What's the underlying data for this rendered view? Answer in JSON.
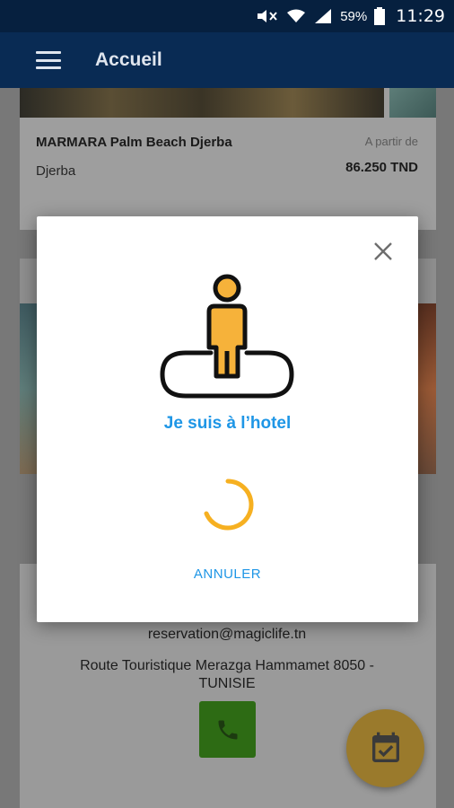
{
  "status_bar": {
    "battery_percent": "59%",
    "time": "11:29",
    "icons": [
      "mute-icon",
      "wifi-icon",
      "signal-icon",
      "battery-icon"
    ]
  },
  "app_bar": {
    "title": "Accueil",
    "menu_icon": "hamburger-menu-icon"
  },
  "hotel_card": {
    "name": "MARMARA Palm Beach Djerba",
    "city": "Djerba",
    "price_prefix": "A partir de",
    "price": "86.250 TND"
  },
  "contact": {
    "email": "reservation@magiclife.tn",
    "address": "Route Touristique Merazga Hammamet 8050 - TUNISIE",
    "phone_icon": "phone-icon"
  },
  "fab": {
    "icon": "calendar-check-icon"
  },
  "dialog": {
    "close_icon": "close-icon",
    "illustration": "person-at-hotel-icon",
    "title": "Je suis à l’hotel",
    "spinner": "loading-spinner",
    "cancel_label": "ANNULER"
  },
  "colors": {
    "accent": "#1e96e6",
    "spinner": "#f6b021",
    "person_fill": "#f6b23a",
    "app_bar": "#092b54",
    "phone_button": "#2d6b14",
    "fab": "#9a7a2c"
  }
}
